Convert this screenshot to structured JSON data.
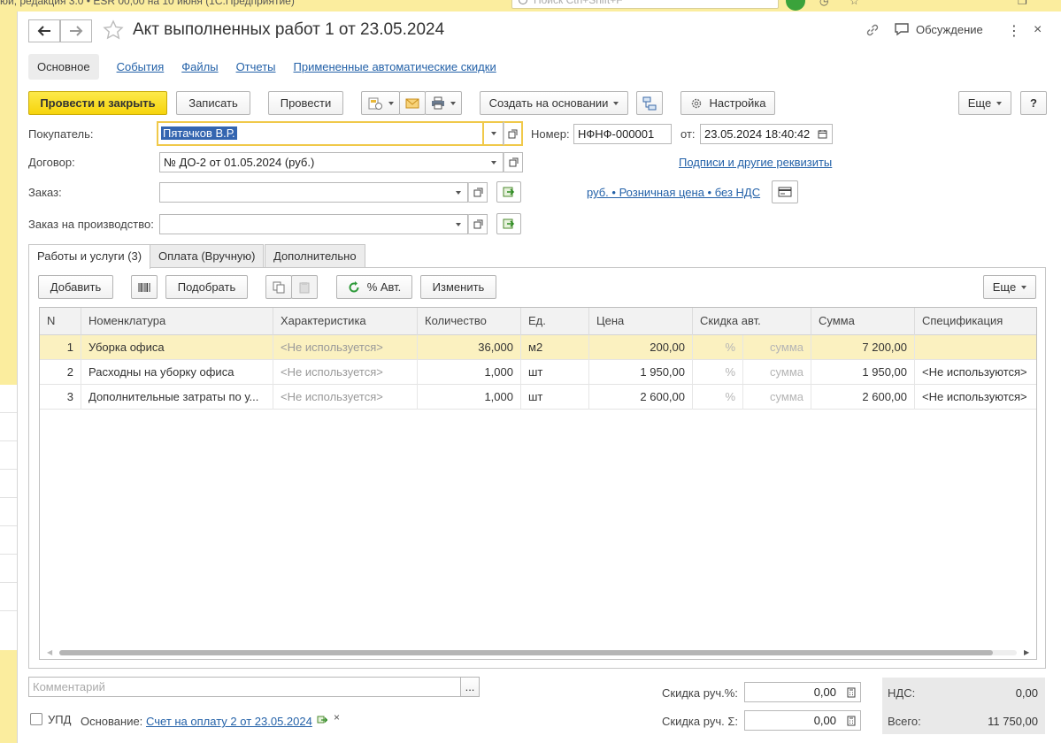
{
  "app_bar": {
    "title": "юй, редакция 3.0 • ESR 00,00 на 10 июня (1С:Предприятие)",
    "search_placeholder": "Поиск Ctrl+Shift+F"
  },
  "header": {
    "title": "Акт выполненных работ 1 от 23.05.2024",
    "discussion": "Обсуждение"
  },
  "nav_tabs": {
    "main": "Основное",
    "links": [
      "События",
      "Файлы",
      "Отчеты",
      "Примененные автоматические скидки"
    ]
  },
  "toolbar": {
    "post_close": "Провести и закрыть",
    "save": "Записать",
    "post": "Провести",
    "create_based": "Создать на основании",
    "settings": "Настройка",
    "more": "Еще",
    "help": "?"
  },
  "form": {
    "buyer_label": "Покупатель:",
    "buyer_value": "Пятачков В.Р.",
    "number_label": "Номер:",
    "number_value": "НФНФ-000001",
    "date_label": "от:",
    "date_value": "23.05.2024 18:40:42",
    "contract_label": "Договор:",
    "contract_value": "№ ДО-2 от 01.05.2024 (руб.)",
    "signatures_link": "Подписи и другие реквизиты",
    "order_label": "Заказ:",
    "order_value": "",
    "price_link": "руб. • Розничная цена • без НДС",
    "production_order_label": "Заказ на производство:",
    "production_order_value": ""
  },
  "page_tabs": [
    "Работы и услуги (3)",
    "Оплата (Вручную)",
    "Дополнительно"
  ],
  "table_toolbar": {
    "add": "Добавить",
    "pick": "Подобрать",
    "auto_percent": "% Авт.",
    "change": "Изменить",
    "more": "Еще"
  },
  "table": {
    "columns": [
      "N",
      "Номенклатура",
      "Характеристика",
      "Количество",
      "Ед.",
      "Цена",
      "Скидка авт.",
      "Сумма",
      "Спецификация"
    ],
    "rows": [
      {
        "n": "1",
        "name": "Уборка офиса",
        "characteristic": "<Не используется>",
        "qty": "36,000",
        "unit": "м2",
        "price": "200,00",
        "disc_pct": "%",
        "disc_sum": "сумма",
        "sum": "7 200,00",
        "spec": ""
      },
      {
        "n": "2",
        "name": "Расходны на уборку офиса",
        "characteristic": "<Не используется>",
        "qty": "1,000",
        "unit": "шт",
        "price": "1 950,00",
        "disc_pct": "%",
        "disc_sum": "сумма",
        "sum": "1 950,00",
        "spec": "<Не используются>"
      },
      {
        "n": "3",
        "name": "Дополнительные затраты по у...",
        "characteristic": "<Не используется>",
        "qty": "1,000",
        "unit": "шт",
        "price": "2 600,00",
        "disc_pct": "%",
        "disc_sum": "сумма",
        "sum": "2 600,00",
        "spec": "<Не используются>"
      }
    ]
  },
  "footer": {
    "comment_placeholder": "Комментарий",
    "comment_btn": "...",
    "upd_label": "УПД",
    "basis_label": "Основание:",
    "basis_link": "Счет на оплату 2 от 23.05.2024",
    "basis_clear": "×",
    "manual_disc_pct_label": "Скидка руч.%:",
    "manual_disc_pct_value": "0,00",
    "manual_disc_sum_label": "Скидка руч. Σ:",
    "manual_disc_sum_value": "0,00",
    "vat_label": "НДС:",
    "vat_value": "0,00",
    "total_label": "Всего:",
    "total_value": "11 750,00"
  },
  "colors": {
    "accent_yellow": "#f6d40c",
    "link_blue": "#2361a8",
    "selected_row": "#fbf1c0",
    "background": "#fbed9e"
  }
}
